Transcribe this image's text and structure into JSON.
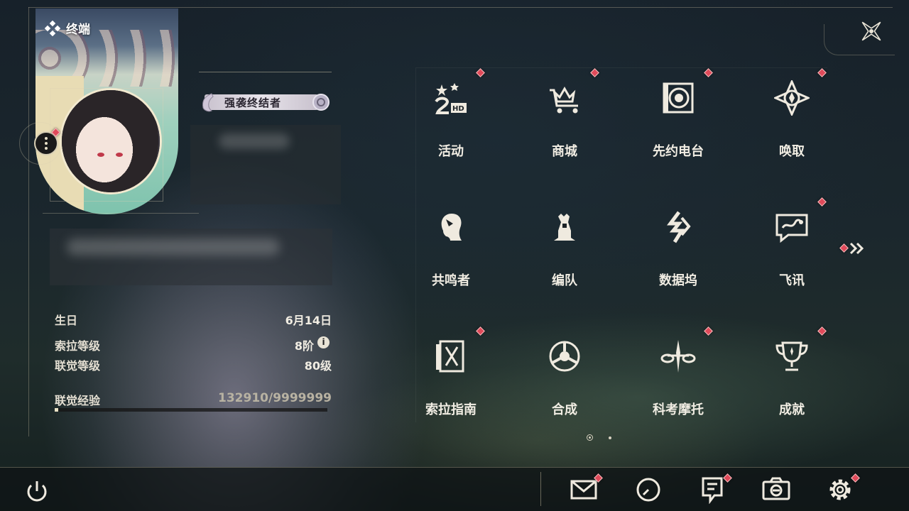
{
  "header": {
    "title": "终端"
  },
  "profile": {
    "badge_title": "强袭终结者",
    "stats": [
      {
        "label": "生日",
        "value": "6月14日"
      },
      {
        "label": "索拉等级",
        "value": "8阶"
      },
      {
        "label": "联觉等级",
        "value": "80级"
      }
    ],
    "exp_label": "联觉经验",
    "exp_value": "132910/9999999",
    "exp_fraction": 0.0133
  },
  "menu": {
    "items": [
      {
        "label": "活动",
        "icon": "event-2hd-icon",
        "has_alert": true
      },
      {
        "label": "商城",
        "icon": "shop-cart-icon",
        "has_alert": true
      },
      {
        "label": "先约电台",
        "icon": "radio-station-icon",
        "has_alert": true
      },
      {
        "label": "唤取",
        "icon": "summon-compass-icon",
        "has_alert": true
      },
      {
        "label": "共鸣者",
        "icon": "resonator-head-icon",
        "has_alert": false
      },
      {
        "label": "编队",
        "icon": "team-chess-icon",
        "has_alert": false
      },
      {
        "label": "数据坞",
        "icon": "data-dock-icon",
        "has_alert": false
      },
      {
        "label": "飞讯",
        "icon": "message-chat-icon",
        "has_alert": true
      },
      {
        "label": "索拉指南",
        "icon": "guidebook-icon",
        "has_alert": true
      },
      {
        "label": "合成",
        "icon": "synthesis-icon",
        "has_alert": false
      },
      {
        "label": "科考摩托",
        "icon": "motorbike-icon",
        "has_alert": true
      },
      {
        "label": "成就",
        "icon": "trophy-icon",
        "has_alert": true
      }
    ],
    "page_current": 1,
    "page_total": 2
  },
  "bottom_bar": {
    "icons": [
      "power-icon",
      "mail-icon",
      "clock-icon",
      "notice-icon",
      "camera-icon",
      "settings-gear-icon"
    ]
  },
  "colors": {
    "alert": "#e04a5a",
    "accent": "#e8e0c4"
  }
}
